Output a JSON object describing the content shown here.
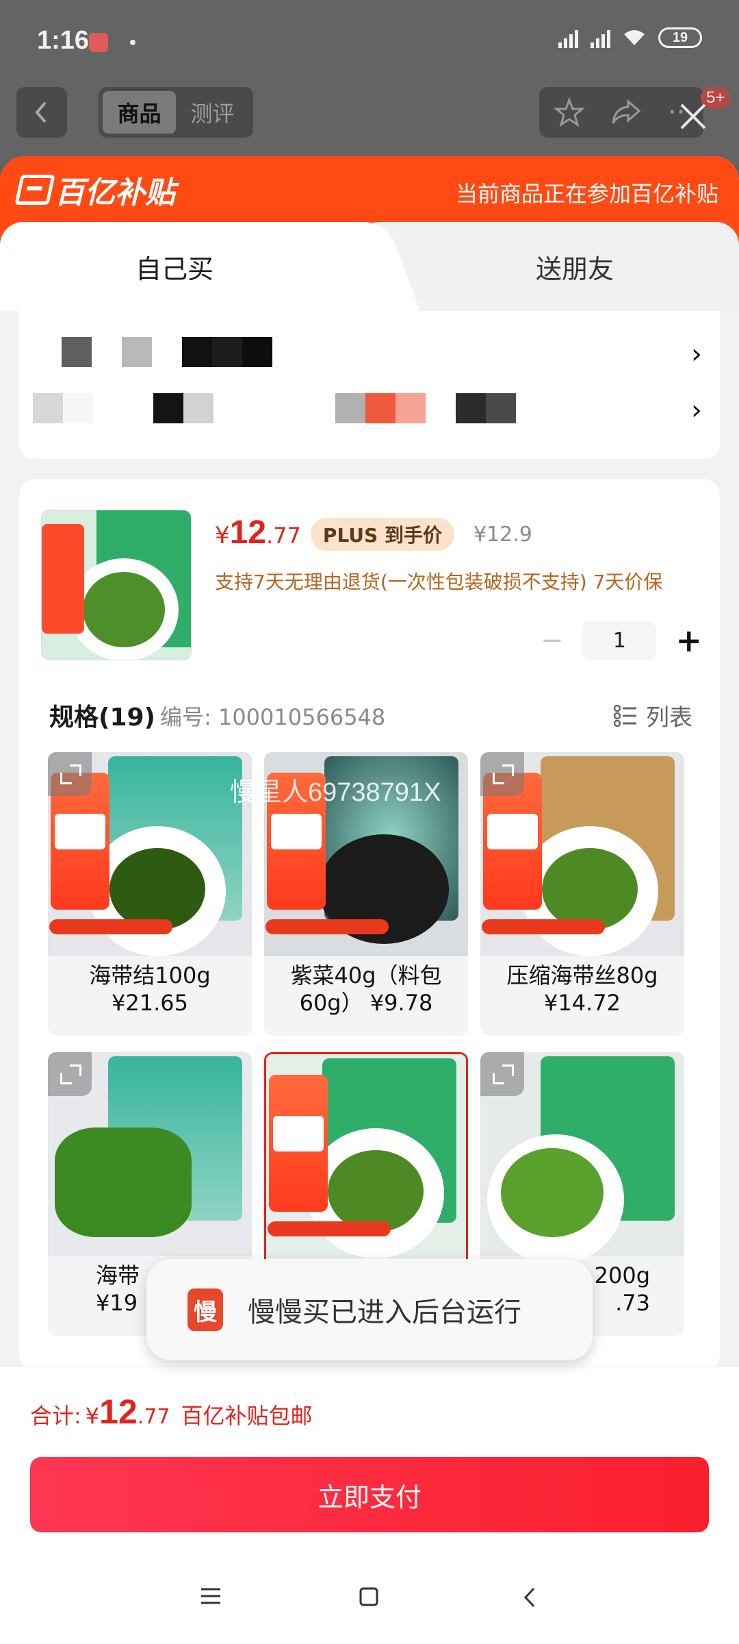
{
  "status": {
    "time": "1:16",
    "battery": "19"
  },
  "nav": {
    "tab_product": "商品",
    "tab_review": "测评",
    "more_badge": "5+"
  },
  "sheet": {
    "brand": "百亿补贴",
    "notice": "当前商品正在参加百亿补贴",
    "tab_self": "自己买",
    "tab_gift": "送朋友"
  },
  "product": {
    "currency": "¥",
    "price_int": "12",
    "price_dec": ".77",
    "plus_tag": "PLUS 到手价",
    "orig_price": "¥12.9",
    "promise": "支持7天无理由退货(一次性包装破损不支持) 7天价保",
    "qty": "1"
  },
  "specs": {
    "title": "规格(19)",
    "code": "编号: 100010566548",
    "list_label": "列表",
    "items": [
      {
        "label": "海带结100g\n¥21.65"
      },
      {
        "label": "紫菜40g（料包60g） ¥9.78"
      },
      {
        "label": "压缩海带丝80g\n¥14.72"
      },
      {
        "label": "海带\n¥19"
      },
      {
        "label": ""
      },
      {
        "label": "200g\n.73"
      }
    ]
  },
  "watermark": "慢星人69738791X",
  "toast": {
    "icon_text": "慢",
    "text": "慢慢买已进入后台运行"
  },
  "total": {
    "label": "合计:",
    "currency": "¥",
    "int": "12",
    "dec": ".77",
    "note": "百亿补贴包邮"
  },
  "pay_button": "立即支付",
  "colors": {
    "accent": "#e3231b",
    "header": "#ff4a13",
    "pay": "#fa1f2d"
  }
}
